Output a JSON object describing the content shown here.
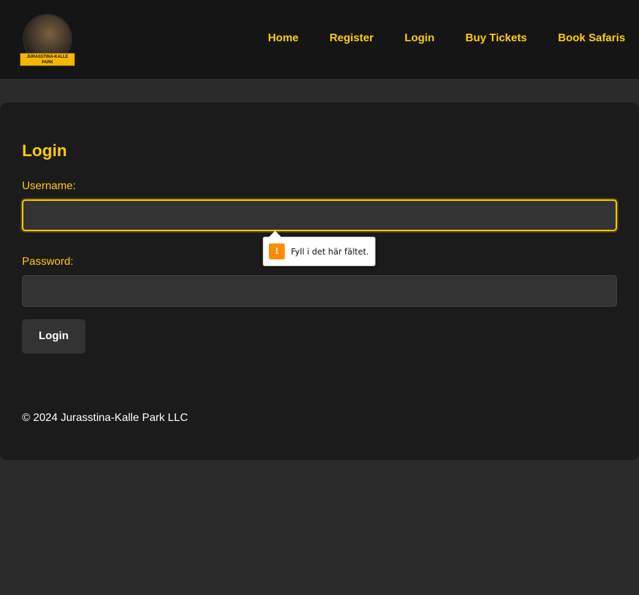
{
  "logo": {
    "text": "JURASSTINA-KALLE PARK"
  },
  "nav": [
    "Home",
    "Register",
    "Login",
    "Buy Tickets",
    "Book Safaris"
  ],
  "form": {
    "title": "Login",
    "username_label": "Username:",
    "password_label": "Password:",
    "username_value": "",
    "password_value": "",
    "submit": "Login"
  },
  "tooltip": {
    "text": "Fyll i det här fältet.",
    "icon": "warning-icon",
    "color": "#ff8c00"
  },
  "footer": "© 2024 Jurasstina-Kalle Park LLC",
  "colors": {
    "accent": "#ffcc00",
    "bg": "#2b2b2b"
  }
}
